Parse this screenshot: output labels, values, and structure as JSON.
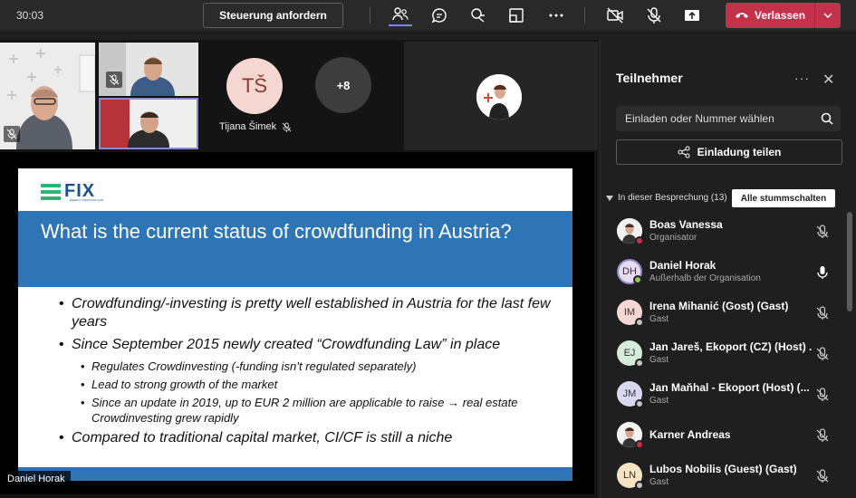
{
  "topbar": {
    "timer": "30:03",
    "control_button": "Steuerung anfordern",
    "leave_label": "Verlassen",
    "icons": [
      "people-icon",
      "chat-icon",
      "reactions-icon",
      "rooms-icon",
      "more-icon",
      "camera-off-icon",
      "mic-off-icon",
      "share-icon"
    ],
    "leave_color": "#c4314b"
  },
  "stage": {
    "tile_tijana_initials": "TŠ",
    "tile_tijana_name": "Tijana Šimek",
    "more_count": "+8",
    "presenter_name": "Daniel Horak"
  },
  "slide": {
    "logo": "FIX",
    "logo_sub": "ENERGY FINANCING HUB",
    "title": "What is the current status of crowdfunding in Austria?",
    "accent": "#2e75b6",
    "bullets": {
      "b1": "Crowdfunding/-investing is pretty well established in Austria for the last few years",
      "b2": "Since September 2015 newly created “Crowdfunding Law” in place",
      "b2a": "Regulates Crowdinvesting (-funding isn’t regulated separately)",
      "b2b": "Lead to strong growth of the market",
      "b2c": "Since an update in 2019, up to EUR 2 million are applicable to raise → real estate Crowdinvesting grew rapidly",
      "b3": "Compared to traditional capital market, CI/CF is still a niche"
    }
  },
  "panel": {
    "title": "Teilnehmer",
    "more": "···",
    "close": "✕",
    "invite_placeholder": "Einladen oder Nummer wählen",
    "share_label": "Einladung teilen",
    "section_label": "In dieser Besprechung (13)",
    "mute_all": "Alle stummschalten",
    "participants": [
      {
        "name": "Boas Vanessa",
        "role": "Organisator",
        "initials": "",
        "bg": "#e8e8e8",
        "status": "#c4314b",
        "mic": "off"
      },
      {
        "name": "Daniel Horak",
        "role": "Außerhalb der Organisation",
        "initials": "DH",
        "bg": "#e9d9f2",
        "status": "#92c353",
        "mic": "on"
      },
      {
        "name": "Irena Mihanić (Gost) (Gast)",
        "role": "Gast",
        "initials": "IM",
        "bg": "#f6d7d4",
        "status": "#c4c4c4",
        "mic": "off"
      },
      {
        "name": "Jan Jareš, Ekoport (CZ) (Host) ...",
        "role": "Gast",
        "initials": "EJ",
        "bg": "#d4ecd9",
        "status": "#c4c4c4",
        "mic": "off"
      },
      {
        "name": "Jan Maňhal - Ekoport (Host) (...",
        "role": "Gast",
        "initials": "JM",
        "bg": "#dad8f0",
        "status": "#c4c4c4",
        "mic": "off"
      },
      {
        "name": "Karner Andreas",
        "role": "",
        "initials": "",
        "bg": "#e8e8e8",
        "status": "#c4314b",
        "mic": "off"
      },
      {
        "name": "Lubos Nobilis (Guest) (Gast)",
        "role": "Gast",
        "initials": "LN",
        "bg": "#f5e3c4",
        "status": "#c4c4c4",
        "mic": "off"
      }
    ]
  }
}
